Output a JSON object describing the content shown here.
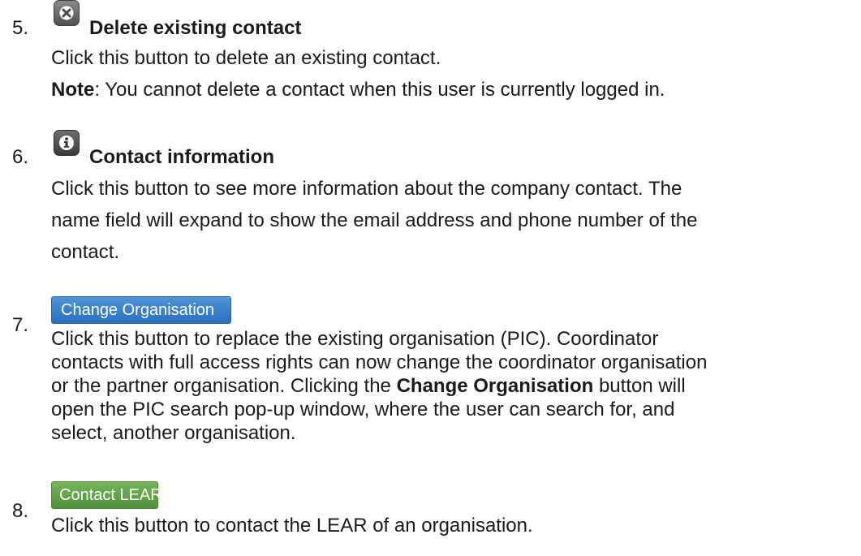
{
  "items": [
    {
      "number": "5.",
      "heading": "Delete existing contact",
      "icon": "delete-x-icon",
      "lines": [
        "Click this button to delete an existing contact."
      ],
      "note_label": "Note",
      "note_text": ": You cannot delete a contact when this user is currently logged in."
    },
    {
      "number": "6.",
      "heading": "Contact information",
      "icon": "info-icon",
      "lines": [
        "Click this button to see more information about the company contact. The",
        "name field will expand to show the email address and phone number of the",
        "contact."
      ]
    },
    {
      "number": "7.",
      "button_label": "Change Organisation",
      "button_color": "#2f74c0",
      "lines": [
        "Click this button to replace the existing organisation (PIC). Coordinator",
        "contacts with full access rights can now change the coordinator organisation",
        "or the partner organisation. Clicking the "
      ],
      "inline_bold": "Change Organisation",
      "line3_suffix": " button will",
      "lines_after": [
        "open the PIC search pop-up window, where the user can search for, and",
        "select, another organisation."
      ]
    },
    {
      "number": "8.",
      "button_label": "Contact LEAR",
      "button_color": "#5a9a40",
      "lines": [
        "Click this button to contact the LEAR of an organisation."
      ]
    }
  ]
}
